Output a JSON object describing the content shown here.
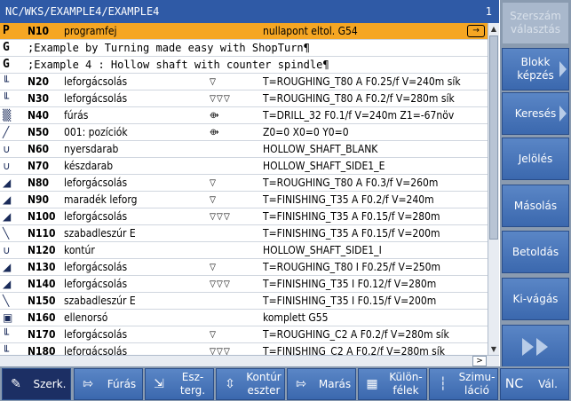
{
  "title": {
    "path": "NC/WKS/EXAMPLE4/EXAMPLE4",
    "channel": "1"
  },
  "rows": [
    {
      "icon": "P",
      "kind": "letter",
      "block": "N10",
      "op": "programfej",
      "mark": "",
      "params": "nullapont eltol. G54",
      "active": true,
      "arrow": "→"
    },
    {
      "icon": "G",
      "kind": "letter",
      "comment": ";Example by Turning made easy with ShopTurn¶"
    },
    {
      "icon": "G",
      "kind": "letter",
      "comment": ";Example 4 : Hollow shaft with counter spindle¶"
    },
    {
      "icon": "╙",
      "block": "N20",
      "op": "leforgácsolás",
      "mark": "▽",
      "params": "T=ROUGHING_T80 A F0.25/f V=240m sík"
    },
    {
      "icon": "╙",
      "block": "N30",
      "op": "leforgácsolás",
      "mark": "▽▽▽",
      "params": "T=ROUGHING_T80 A F0.2/f V=280m sík"
    },
    {
      "icon": "▒",
      "block": "N40",
      "op": "fúrás",
      "mark": "⟴",
      "params": "T=DRILL_32 F0.1/f V=240m Z1=-67növ"
    },
    {
      "icon": "╱",
      "block": "N50",
      "op": "001: pozíciók",
      "mark": "⟴",
      "params": "Z0=0 X0=0 Y0=0"
    },
    {
      "icon": "∪",
      "block": "N60",
      "op": "nyersdarab",
      "mark": "",
      "params": "HOLLOW_SHAFT_BLANK"
    },
    {
      "icon": "∪",
      "block": "N70",
      "op": "készdarab",
      "mark": "",
      "params": "HOLLOW_SHAFT_SIDE1_E"
    },
    {
      "icon": "◢",
      "block": "N80",
      "op": "leforgácsolás",
      "mark": "▽",
      "params": "T=ROUGHING_T80 A F0.3/f V=260m"
    },
    {
      "icon": "◢",
      "block": "N90",
      "op": "maradék leforg",
      "mark": "▽",
      "params": "T=FINISHING_T35 A F0.2/f V=240m"
    },
    {
      "icon": "◢",
      "block": "N100",
      "op": "leforgácsolás",
      "mark": "▽▽▽",
      "params": "T=FINISHING_T35 A F0.15/f V=280m"
    },
    {
      "icon": "╲",
      "block": "N110",
      "op": "szabadleszúr E",
      "mark": "",
      "params": "T=FINISHING_T35 A F0.15/f V=200m"
    },
    {
      "icon": "∪",
      "block": "N120",
      "op": "kontúr",
      "mark": "",
      "params": "HOLLOW_SHAFT_SIDE1_I"
    },
    {
      "icon": "◢",
      "block": "N130",
      "op": "leforgácsolás",
      "mark": "▽",
      "params": "T=ROUGHING_T80 I F0.25/f V=250m"
    },
    {
      "icon": "◢",
      "block": "N140",
      "op": "leforgácsolás",
      "mark": "▽▽▽",
      "params": "T=FINISHING_T35 I F0.12/f V=280m"
    },
    {
      "icon": "╲",
      "block": "N150",
      "op": "szabadleszúr E",
      "mark": "",
      "params": "T=FINISHING_T35 I F0.15/f V=200m"
    },
    {
      "icon": "▣",
      "block": "N160",
      "op": "ellenorsó",
      "mark": "",
      "params": "komplett G55"
    },
    {
      "icon": "╙",
      "block": "N170",
      "op": "leforgácsolás",
      "mark": "▽",
      "params": "T=ROUGHING_C2 A F0.2/f V=280m sík"
    },
    {
      "icon": "╙",
      "block": "N180",
      "op": "leforgácsolás",
      "mark": "▽▽▽",
      "params": "T=FINISHING_C2 A F0.2/f V=280m sík"
    }
  ],
  "vsoftkeys": [
    {
      "label": "Szerszám választás",
      "disabled": true
    },
    {
      "label": "Blokk képzés",
      "chevron": true
    },
    {
      "label": "Keresés",
      "chevron": true
    },
    {
      "label": "Jelölés"
    },
    {
      "label": "Másolás"
    },
    {
      "label": "Betoldás"
    },
    {
      "label": "Ki-vágás"
    },
    {
      "label": "",
      "play": true
    }
  ],
  "hsoftkeys": [
    {
      "label": "Szerk.",
      "icon": "edit-icon",
      "glyph": "✎",
      "selected": true
    },
    {
      "label": "Fúrás",
      "icon": "drill-icon",
      "glyph": "⇰"
    },
    {
      "label": "Esz-terg.",
      "icon": "turning-icon",
      "glyph": "⇲"
    },
    {
      "label": "Kontúr eszter",
      "icon": "contour-turning-icon",
      "glyph": "⇳"
    },
    {
      "label": "Marás",
      "icon": "milling-icon",
      "glyph": "⇰"
    },
    {
      "label": "Külön-félek",
      "icon": "misc-icon",
      "glyph": "▦"
    },
    {
      "label": "Szimu-láció",
      "icon": "simulation-icon",
      "glyph": "┆"
    },
    {
      "label": "Vál.",
      "icon": "nc-select-icon",
      "glyph": "NC"
    }
  ],
  "colors": {
    "title_bg": "#2f5aa6",
    "active_row": "#f5a623",
    "softkey": "#3b68ae"
  }
}
